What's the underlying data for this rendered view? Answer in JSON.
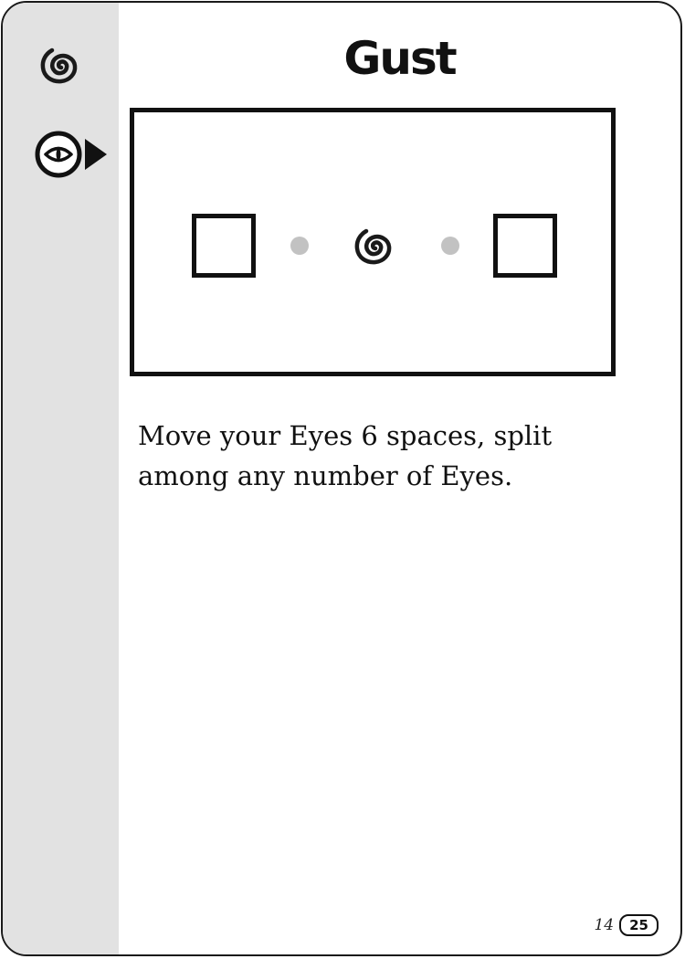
{
  "card": {
    "title": "Gust",
    "description": "Move your Eyes 6 spaces, split among any number of Eyes.",
    "icons": {
      "element": "spiral-icon",
      "action": "eye-move-icon",
      "diagram_center": "spiral-icon"
    },
    "footer": {
      "page_number": "14",
      "card_number": "25"
    },
    "colors": {
      "ink": "#111111",
      "sidebar": "#e2e2e2",
      "dot": "#c2c2c2"
    }
  }
}
